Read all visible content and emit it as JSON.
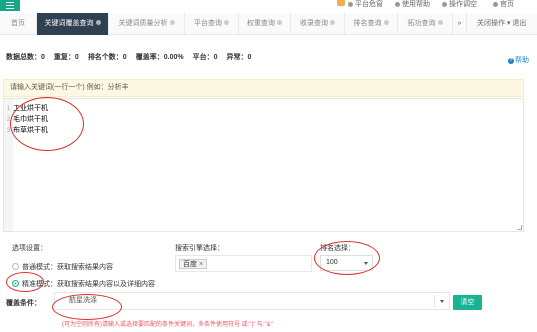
{
  "topbar": {
    "tools": [
      {
        "label": "平台危窗",
        "icon": "bell-icon"
      },
      {
        "label": "使用帮助",
        "icon": "question-icon"
      },
      {
        "label": "操作调空",
        "icon": "gear-icon"
      },
      {
        "label": "官页",
        "icon": "user-icon"
      }
    ]
  },
  "tabs": {
    "items": [
      {
        "label": "首页"
      },
      {
        "label": "关键词覆盖查询"
      },
      {
        "label": "关键词质量分析"
      },
      {
        "label": "平台查询"
      },
      {
        "label": "权重查询"
      },
      {
        "label": "收录查询"
      },
      {
        "label": "排名查询"
      },
      {
        "label": "拓功查询"
      }
    ],
    "nav_arrow": "»",
    "ops_label": "关闭操作 ▾",
    "back_label": "退出"
  },
  "stats": {
    "total": "数据总数：0",
    "dup": "重复：0",
    "rank_count": "排名个数：0",
    "coverage": "覆盖率：0.00%",
    "platform": "平台：0",
    "abnormal": "异常：0"
  },
  "help": {
    "label": "帮助"
  },
  "hint": {
    "text": "请输入关键词(一行一个)  例如：分析丰"
  },
  "editor": {
    "lines": [
      {
        "num": "1",
        "text": "工业烘干机"
      },
      {
        "num": "2",
        "text": "毛巾烘干机"
      },
      {
        "num": "3",
        "text": "布草烘干机"
      }
    ]
  },
  "options": {
    "title": "选项设置：",
    "normal_mode": "普通模式：获取搜索结果内容",
    "exact_mode": "精准模式：获取搜索结果内容以及详细内容",
    "selected_mode": "exact"
  },
  "engine": {
    "label": "搜索引擎选择：",
    "chip": "百度",
    "chip_remove": "×"
  },
  "rank": {
    "label": "排名选择：",
    "value": "100"
  },
  "condition": {
    "label": "覆盖条件：",
    "value": "航星洗涤",
    "clear_label": "清空",
    "hint": "(可为空则所有)请输入或选择要匹配的条件关键词，多条件使用符号 或:\"|\" 与:\"&\""
  },
  "colors": {
    "accent": "#1ab394",
    "sidebar_dark": "#2f4050",
    "annotation_red": "#d9302b",
    "hint_bg": "#fcf8e3"
  }
}
